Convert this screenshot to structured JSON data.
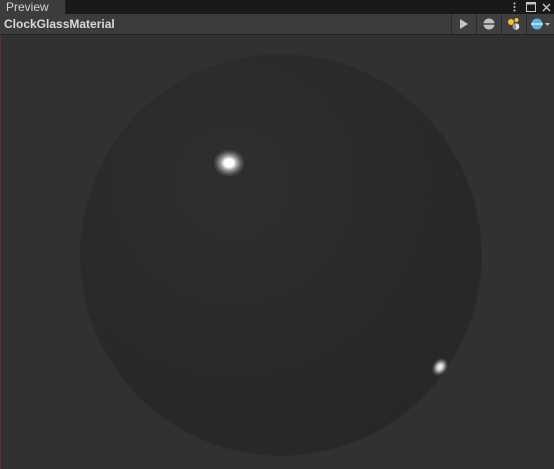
{
  "tab": {
    "label": "Preview"
  },
  "toolbar": {
    "material_name": "ClockGlassMaterial"
  },
  "icons": {
    "more": "kebab-menu-icon",
    "maximize": "maximize-icon",
    "close": "close-icon",
    "play": "play-icon",
    "mesh": "sphere-mesh-icon",
    "lights": "light-toggle-icon",
    "background": "preview-background-icon"
  },
  "colors": {
    "light_icon": "#f2c233",
    "background_icon": "#5fb3e8"
  }
}
